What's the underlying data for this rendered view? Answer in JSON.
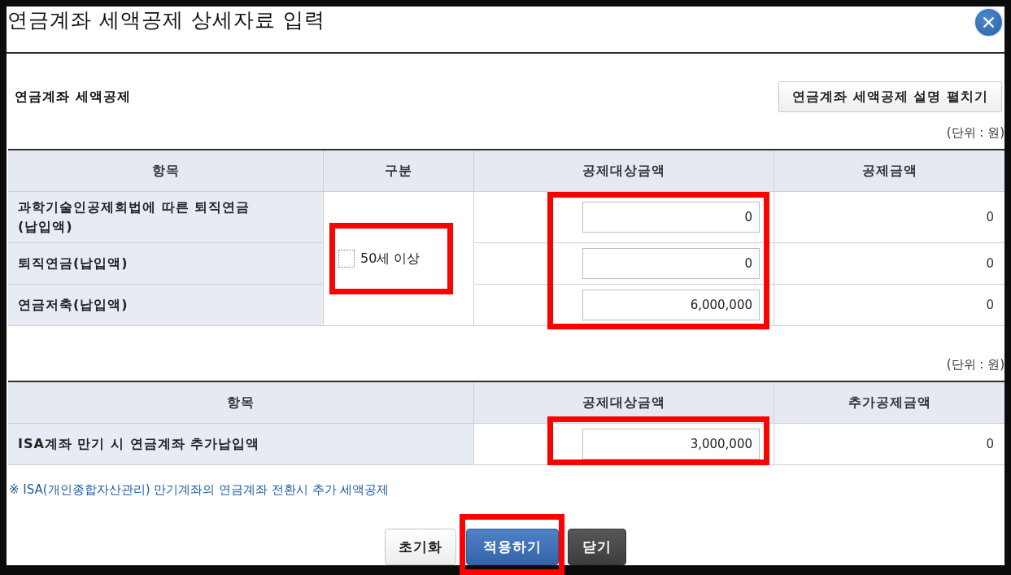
{
  "window": {
    "title": "연금계좌 세액공제 상세자료 입력"
  },
  "section": {
    "heading": "연금계좌 세액공제",
    "toggle_button": "연금계좌 세액공제 설명 펼치기"
  },
  "table_1": {
    "unit_note": "(단위 : 원)",
    "columns": [
      "항목",
      "구분",
      "공제대상금액",
      "공제금액"
    ],
    "category": {
      "label": "50세 이상",
      "checked": false,
      "highlighted": true
    },
    "amounts_highlighted": true,
    "rows": [
      {
        "item": "과학기술인공제회법에 따른 퇴직연금\n(납입액)",
        "amount": "0",
        "deduction": "0"
      },
      {
        "item": "퇴직연금(납입액)",
        "amount": "0",
        "deduction": "0"
      },
      {
        "item": "연금저축(납입액)",
        "amount": "6,000,000",
        "deduction": "0"
      }
    ]
  },
  "table_2": {
    "unit_note": "(단위 : 원)",
    "columns": [
      "항목",
      "공제대상금액",
      "추가공제금액"
    ],
    "rows": [
      {
        "item": "ISA계좌 만기 시 연금계좌 추가납입액",
        "amount": "3,000,000",
        "deduction": "0",
        "highlighted": true
      }
    ]
  },
  "note": "※ ISA(개인종합자산관리) 만기계좌의 연금계좌 전환시 추가 세액공제",
  "buttons": [
    {
      "label": "초기화",
      "kind": "reset",
      "highlighted": false
    },
    {
      "label": "적용하기",
      "kind": "apply",
      "highlighted": true
    },
    {
      "label": "닫기",
      "kind": "close",
      "highlighted": false
    }
  ]
}
